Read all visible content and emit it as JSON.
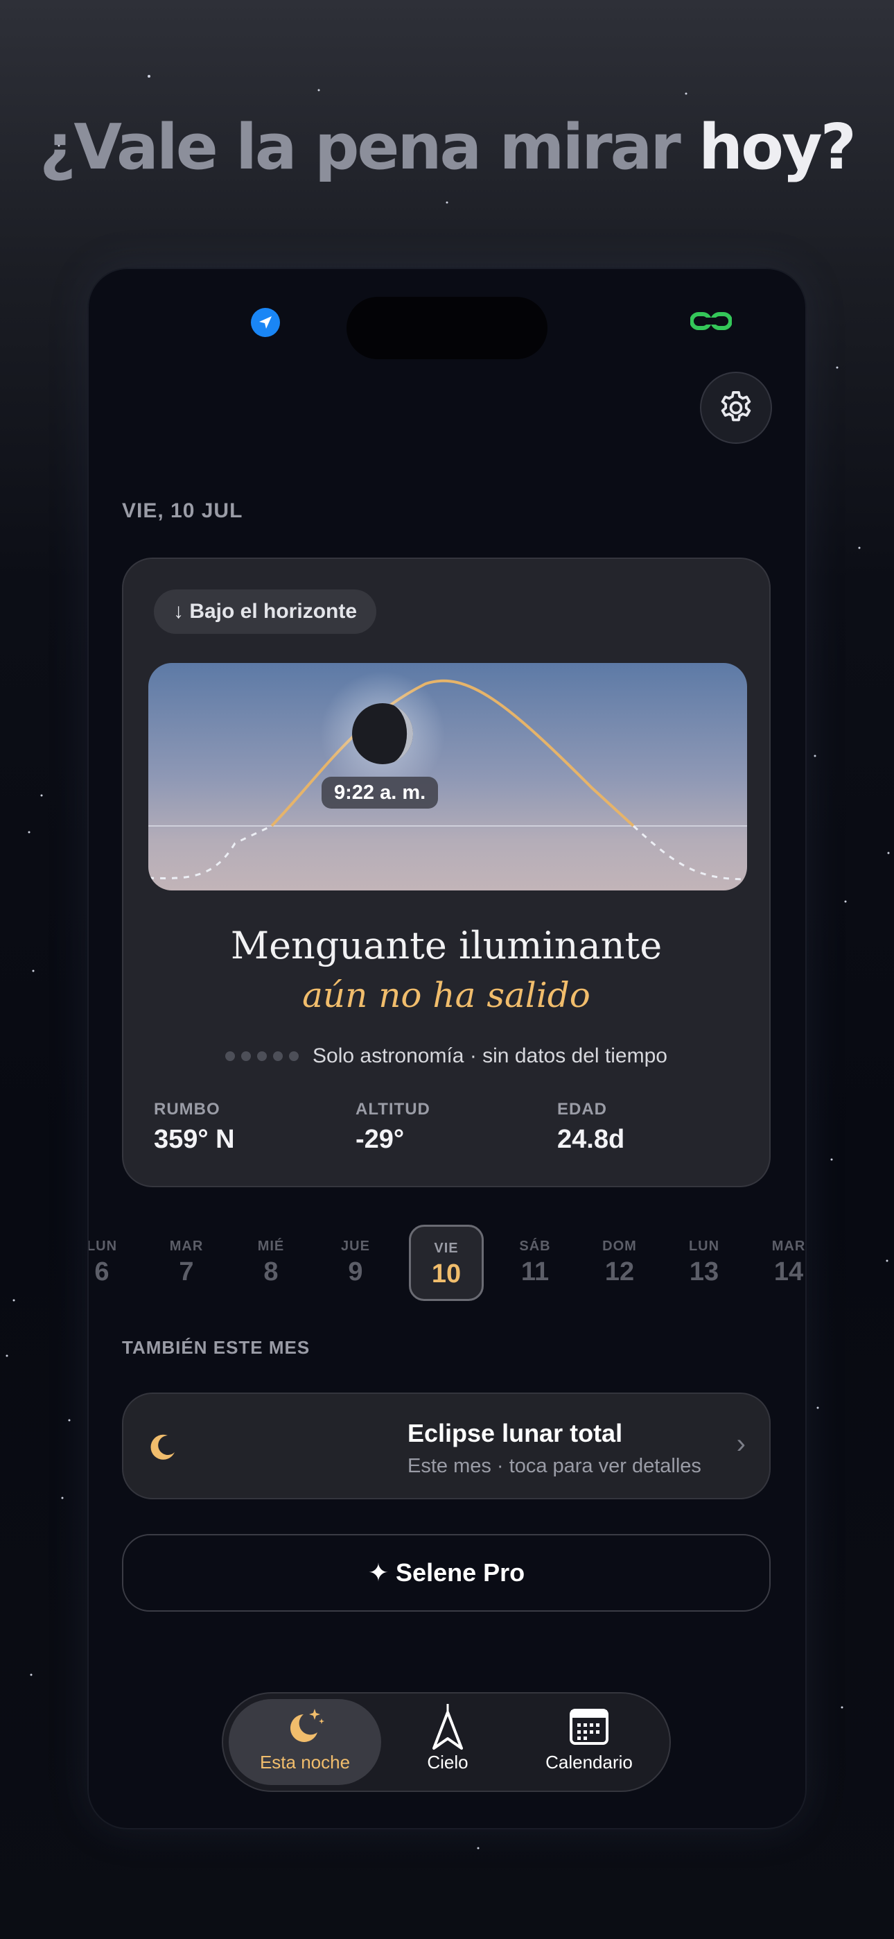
{
  "headline": {
    "part1": "¿Vale la pena mirar ",
    "part2": "hoy?"
  },
  "status_bar": {
    "location_icon": "location-arrow-icon",
    "link_icon": "link-icon"
  },
  "settings_icon": "gear-icon",
  "date_label": "VIE, 10 JUL",
  "moon_card": {
    "horizon_pill": "↓ Bajo el horizonte",
    "rise_time": "9:22 a. m.",
    "phase_name": "Menguante iluminante",
    "phase_status": "aún no ha salido",
    "weather_text": "Solo astronomía · sin datos del tiempo",
    "stats": [
      {
        "label": "RUMBO",
        "value": "359° N"
      },
      {
        "label": "ALTITUD",
        "value": "-29°"
      },
      {
        "label": "EDAD",
        "value": "24.8d"
      }
    ]
  },
  "days": [
    {
      "name": "LUN",
      "num": "6"
    },
    {
      "name": "MAR",
      "num": "7"
    },
    {
      "name": "MIÉ",
      "num": "8"
    },
    {
      "name": "JUE",
      "num": "9"
    },
    {
      "name": "VIE",
      "num": "10",
      "selected": true
    },
    {
      "name": "SÁB",
      "num": "11"
    },
    {
      "name": "DOM",
      "num": "12"
    },
    {
      "name": "LUN",
      "num": "13"
    },
    {
      "name": "MAR",
      "num": "14"
    }
  ],
  "section_label": "TAMBIÉN ESTE MES",
  "event": {
    "title": "Eclipse lunar total",
    "subtitle": "Este mes · toca para ver detalles",
    "icon": "crescent-moon-icon"
  },
  "pro_button": "✦ Selene Pro",
  "tabs": [
    {
      "label": "Esta noche",
      "icon": "moon-stars-icon",
      "active": true
    },
    {
      "label": "Cielo",
      "icon": "compass-needle-icon"
    },
    {
      "label": "Calendario",
      "icon": "calendar-icon"
    }
  ],
  "colors": {
    "accent": "#f1bd6c",
    "location_blue": "#1a86f5",
    "link_green": "#34c759"
  }
}
